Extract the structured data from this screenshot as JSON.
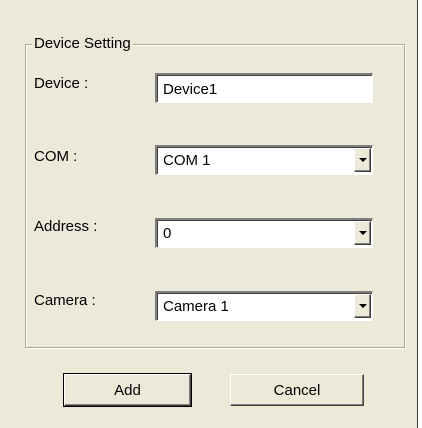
{
  "dialog": {
    "group_title": "Device Setting",
    "fields": {
      "device": {
        "label": "Device :",
        "value": "Device1"
      },
      "com": {
        "label": "COM :",
        "value": "COM 1"
      },
      "address": {
        "label": "Address :",
        "value": "0"
      },
      "camera": {
        "label": "Camera :",
        "value": "Camera 1"
      }
    },
    "buttons": {
      "add": "Add",
      "cancel": "Cancel"
    }
  },
  "icons": {
    "combo_dropdown": "chevron-down-icon"
  }
}
